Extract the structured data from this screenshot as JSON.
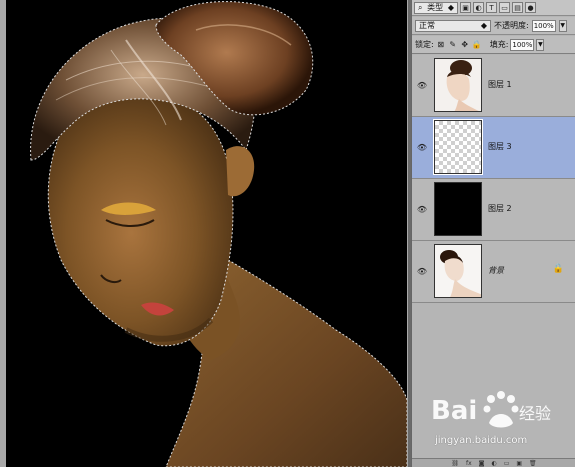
{
  "layers_panel": {
    "filter_kind": "类型",
    "blend_mode": "正常",
    "opacity_label": "不透明度:",
    "opacity_value": "100%",
    "lock_label": "锁定:",
    "fill_label": "填充:",
    "fill_value": "100%",
    "layers": [
      {
        "name": "图层 1",
        "visible": true,
        "selected": false,
        "thumbnail": "woman-portrait"
      },
      {
        "name": "图层 3",
        "visible": true,
        "selected": true,
        "thumbnail": "transparent"
      },
      {
        "name": "图层 2",
        "visible": true,
        "selected": false,
        "thumbnail": "black-fill"
      },
      {
        "name": "背景",
        "visible": true,
        "selected": false,
        "locked": true,
        "thumbnail": "woman-portrait"
      }
    ]
  },
  "watermark": {
    "brand": "Bai 经验",
    "url": "jingyan.baidu.com"
  },
  "icons": {
    "visibility": "eye-icon",
    "lock": "lock-icon"
  },
  "colors": {
    "canvas": "#000000",
    "panel": "#b5b5b5",
    "selected_layer": "#9aaedb"
  }
}
